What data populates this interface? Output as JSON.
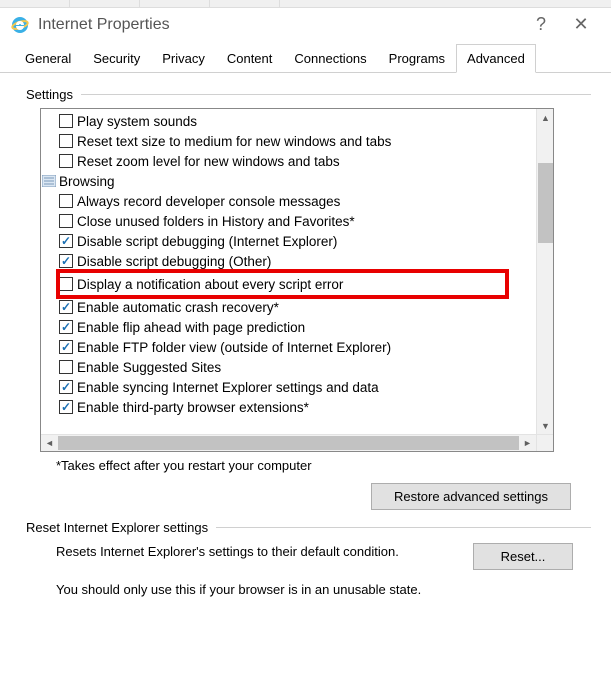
{
  "window": {
    "title": "Internet Properties"
  },
  "tabs": [
    {
      "label": "General"
    },
    {
      "label": "Security"
    },
    {
      "label": "Privacy"
    },
    {
      "label": "Content"
    },
    {
      "label": "Connections"
    },
    {
      "label": "Programs"
    },
    {
      "label": "Advanced",
      "active": true
    }
  ],
  "settings": {
    "groupLabel": "Settings",
    "note": "*Takes effect after you restart your computer",
    "restoreBtn": "Restore advanced settings",
    "items": [
      {
        "type": "check",
        "checked": false,
        "label": "Play system sounds"
      },
      {
        "type": "check",
        "checked": false,
        "label": "Reset text size to medium for new windows and tabs"
      },
      {
        "type": "check",
        "checked": false,
        "label": "Reset zoom level for new windows and tabs"
      },
      {
        "type": "category",
        "label": "Browsing"
      },
      {
        "type": "check",
        "checked": false,
        "label": "Always record developer console messages"
      },
      {
        "type": "check",
        "checked": false,
        "label": "Close unused folders in History and Favorites*"
      },
      {
        "type": "check",
        "checked": true,
        "label": "Disable script debugging (Internet Explorer)"
      },
      {
        "type": "check",
        "checked": true,
        "label": "Disable script debugging (Other)"
      },
      {
        "type": "check",
        "checked": false,
        "label": "Display a notification about every script error",
        "highlight": true
      },
      {
        "type": "check",
        "checked": true,
        "label": "Enable automatic crash recovery*"
      },
      {
        "type": "check",
        "checked": true,
        "label": "Enable flip ahead with page prediction"
      },
      {
        "type": "check",
        "checked": true,
        "label": "Enable FTP folder view (outside of Internet Explorer)"
      },
      {
        "type": "check",
        "checked": false,
        "label": "Enable Suggested Sites"
      },
      {
        "type": "check",
        "checked": true,
        "label": "Enable syncing Internet Explorer settings and data"
      },
      {
        "type": "check",
        "checked": true,
        "label": "Enable third-party browser extensions*"
      }
    ]
  },
  "reset": {
    "groupLabel": "Reset Internet Explorer settings",
    "desc": "Resets Internet Explorer's settings to their default condition.",
    "btn": "Reset...",
    "warning": "You should only use this if your browser is in an unusable state."
  }
}
